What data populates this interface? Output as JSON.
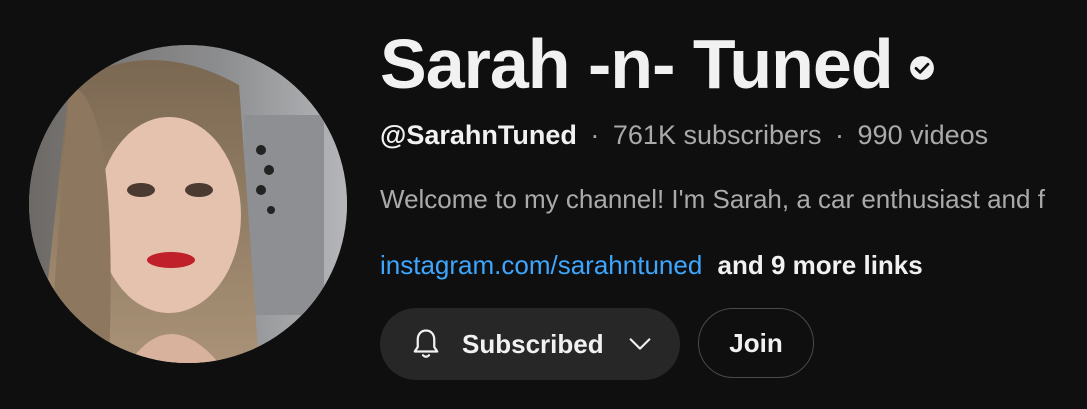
{
  "channel": {
    "title": "Sarah -n- Tuned",
    "verified": true,
    "handle": "@SarahnTuned",
    "subscribers": "761K subscribers",
    "videos": "990 videos",
    "separator": "·",
    "description": "Welcome to my channel!  I'm Sarah, a car enthusiast and f",
    "link_text": "instagram.com/sarahntuned",
    "more_links": "and 9 more links"
  },
  "buttons": {
    "subscribed_label": "Subscribed",
    "join_label": "Join"
  },
  "icons": {
    "verified": "verified-check-icon",
    "bell": "bell-icon",
    "chevron": "chevron-down-icon"
  },
  "colors": {
    "background": "#0f0f0f",
    "link": "#3ea6ff",
    "secondary_text": "#aaaaaa",
    "button_bg": "#272727"
  }
}
